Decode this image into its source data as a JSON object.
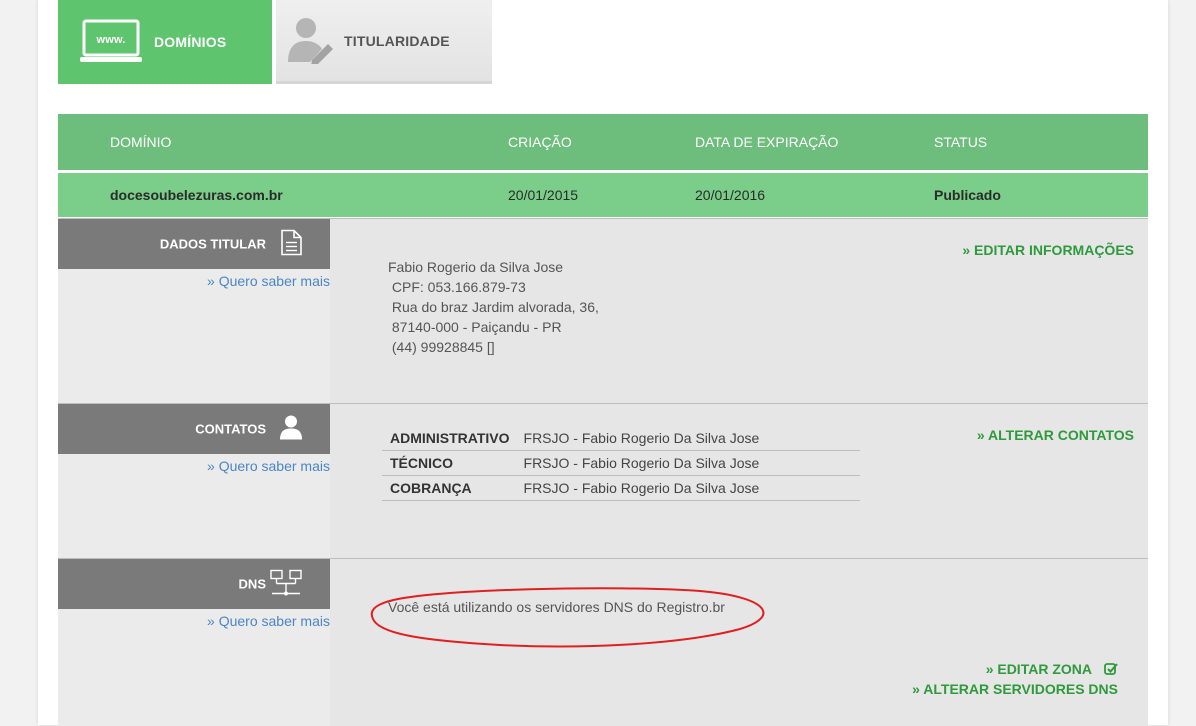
{
  "tabs": {
    "dominios": {
      "label": "DOMÍNIOS",
      "icon_text": "www.",
      "icon": "laptop-icon"
    },
    "titularidade": {
      "label": "TITULARIDADE",
      "icon": "user-edit-icon"
    }
  },
  "grid": {
    "headers": [
      "DOMÍNIO",
      "CRIAÇÃO",
      "DATA DE EXPIRAÇÃO",
      "STATUS"
    ],
    "row": {
      "domain": "docesoubelezuras.com.br",
      "created": "20/01/2015",
      "expires": "20/01/2016",
      "status": "Publicado"
    }
  },
  "titular": {
    "label": "DADOS TITULAR",
    "icon": "document-icon",
    "more_link": "» Quero saber mais",
    "edit_link": "» EDITAR INFORMAÇÕES",
    "lines": [
      "Fabio Rogerio da Silva Jose",
      " CPF: 053.166.879-73",
      " Rua do braz Jardim alvorada, 36,",
      " 87140-000 - Paiçandu - PR",
      " (44) 99928845 []"
    ]
  },
  "contatos": {
    "label": "CONTATOS",
    "icon": "person-icon",
    "more_link": "» Quero saber mais",
    "edit_link": "» ALTERAR CONTATOS",
    "rows": [
      {
        "role": "ADMINISTRATIVO",
        "name": "FRSJO - Fabio Rogerio Da Silva Jose"
      },
      {
        "role": "TÉCNICO",
        "name": "FRSJO - Fabio Rogerio Da Silva Jose"
      },
      {
        "role": "COBRANÇA",
        "name": "FRSJO - Fabio Rogerio Da Silva Jose"
      }
    ]
  },
  "dns": {
    "label": "DNS",
    "icon": "network-icon",
    "more_link": "» Quero saber mais",
    "message": "Você está utilizando os servidores DNS do Registro.br",
    "edit_zone_link": "» EDITAR ZONA",
    "alter_servers_link": "» ALTERAR SERVIDORES DNS"
  },
  "colors": {
    "tab_active": "#5ec46e",
    "header_green": "#6dbe7c",
    "row_green": "#7bcd8a",
    "label_gray": "#7a7a7a",
    "link_blue": "#4a86c5",
    "action_green": "#2e9a3c",
    "annotation_red": "#e02020"
  }
}
